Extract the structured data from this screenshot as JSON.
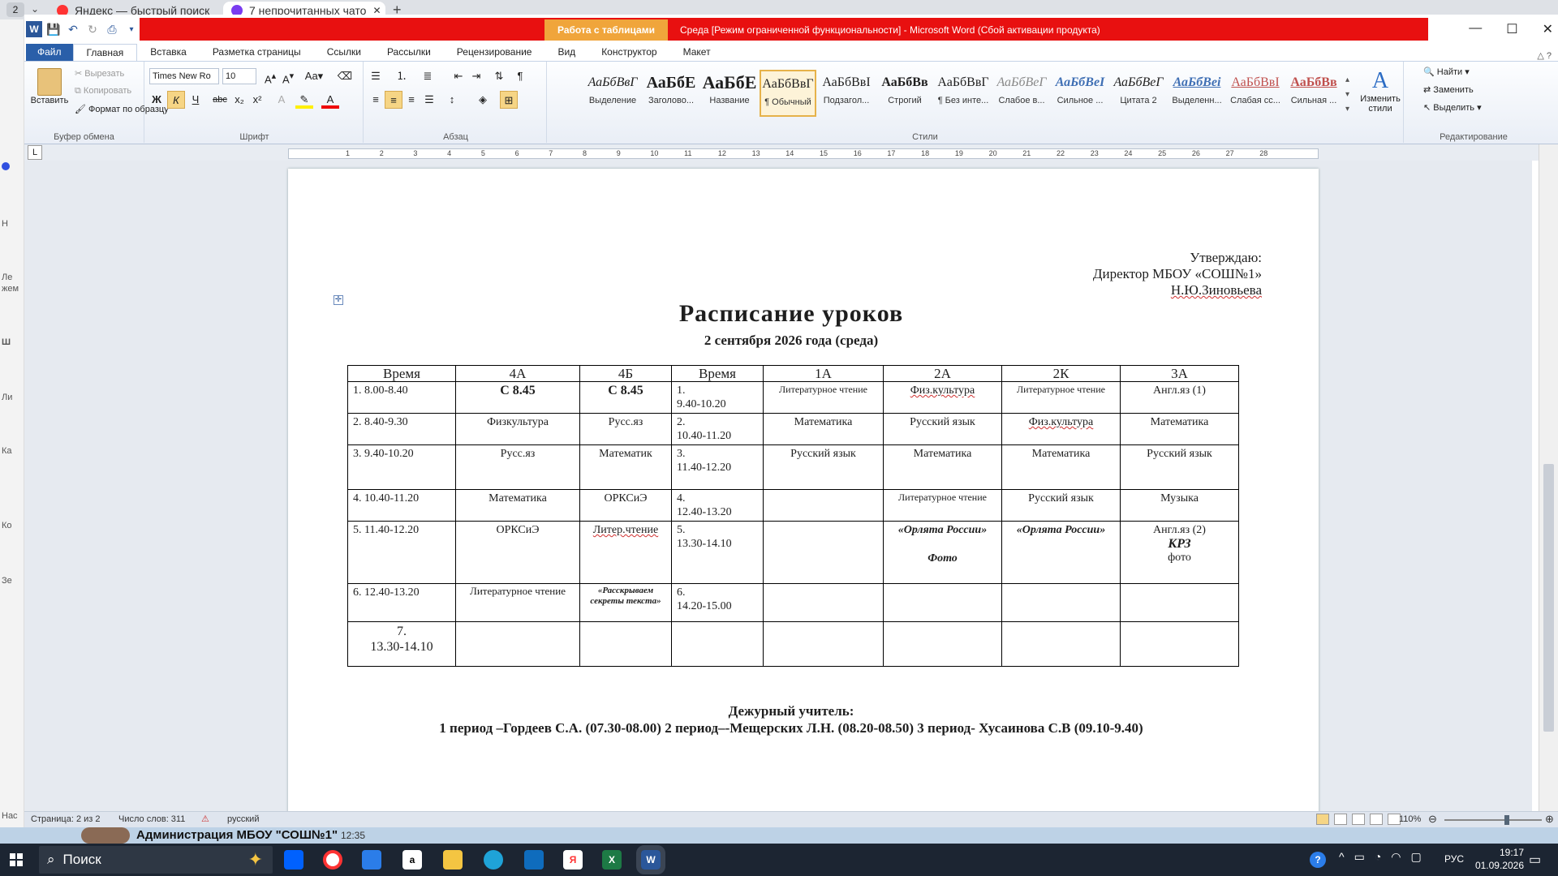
{
  "browser": {
    "tab_count": "2",
    "tabs": [
      {
        "title": "Яндекс — быстрый поиск"
      },
      {
        "title": "7 непрочитанных чато"
      }
    ],
    "sidebar_labels": [
      "Н",
      "Ле",
      "жем",
      "Ш",
      "Ли",
      "Ка",
      "Ко",
      "Зе",
      "Нас"
    ]
  },
  "word": {
    "contextual_tab": "Работа с таблицами",
    "window_title": "Среда [Режим ограниченной функциональности] - Microsoft Word (Сбой активации продукта)",
    "ribbon_tabs": [
      "Файл",
      "Главная",
      "Вставка",
      "Разметка страницы",
      "Ссылки",
      "Рассылки",
      "Рецензирование",
      "Вид",
      "Конструктор",
      "Макет"
    ],
    "active_tab": "Главная",
    "clipboard": {
      "paste": "Вставить",
      "cut": "Вырезать",
      "copy": "Копировать",
      "format_painter": "Формат по образцу",
      "label": "Буфер обмена"
    },
    "font": {
      "name": "Times New Ro",
      "size": "10",
      "label": "Шрифт",
      "bold": "Ж",
      "italic": "К",
      "underline": "Ч"
    },
    "paragraph": {
      "label": "Абзац"
    },
    "styles": {
      "label": "Стили",
      "items": [
        {
          "preview": "АаБбВвГ",
          "name": "Выделение"
        },
        {
          "preview": "АаБбЕ",
          "name": "Заголово..."
        },
        {
          "preview": "АаБбЕ",
          "name": "Название"
        },
        {
          "preview": "АаБбВвГ",
          "name": "¶ Обычный"
        },
        {
          "preview": "АаБбВвI",
          "name": "Подзагол..."
        },
        {
          "preview": "АаБбВв",
          "name": "Строгий"
        },
        {
          "preview": "АаБбВвГ",
          "name": "¶ Без инте..."
        },
        {
          "preview": "АаБбВеГ",
          "name": "Слабое в..."
        },
        {
          "preview": "АаБбВеІ",
          "name": "Сильное ..."
        },
        {
          "preview": "АаБбВеГ",
          "name": "Цитата 2"
        },
        {
          "preview": "АаБбВеі",
          "name": "Выделенн..."
        },
        {
          "preview": "АаБбВвІ",
          "name": "Слабая сс..."
        },
        {
          "preview": "АаБбВв",
          "name": "Сильная ..."
        }
      ],
      "change": "Изменить стили"
    },
    "editing": {
      "label": "Редактирование",
      "find": "Найти",
      "replace": "Заменить",
      "select": "Выделить"
    },
    "ruler_numbers": [
      "1",
      "2",
      "3",
      "4",
      "5",
      "6",
      "7",
      "8",
      "9",
      "10",
      "11",
      "12",
      "13",
      "14",
      "15",
      "16",
      "17",
      "18",
      "19",
      "20",
      "21",
      "22",
      "23",
      "24",
      "25",
      "26",
      "27",
      "28"
    ]
  },
  "document": {
    "approve": [
      "Утверждаю:",
      "Директор МБОУ «СОШ№1»",
      "Н.Ю.Зиновьева"
    ],
    "title": "Расписание  уроков",
    "subtitle": "2 сентября   2026 года (среда)",
    "table": {
      "headers": [
        "Время",
        "4А",
        "4Б",
        "Время",
        "1А",
        "2А",
        "2К",
        "3А"
      ],
      "rows": [
        [
          "1. 8.00-8.40",
          "С 8.45",
          "С 8.45",
          "1.\n 9.40-10.20",
          "Литературное чтение",
          "Физ.культура",
          "Литературное чтение",
          "Англ.яз (1)"
        ],
        [
          "2. 8.40-9.30",
          "Физкультура",
          "Русс.яз",
          "2.\n 10.40-11.20",
          "Математика",
          "Русский язык",
          "Физ.культура",
          "Математика"
        ],
        [
          "3. 9.40-10.20",
          "Русс.яз",
          "Математик",
          "3.\n11.40-12.20",
          "Русский язык",
          "Математика",
          "Математика",
          "Русский язык"
        ],
        [
          "4. 10.40-11.20",
          "Математика",
          "ОРКСиЭ",
          "4.\n12.40-13.20",
          "",
          "Литературное чтение",
          "Русский язык",
          "Музыка"
        ],
        [
          "5. 11.40-12.20",
          "ОРКСиЭ",
          "Литер.чтение",
          "5.\n13.30-14.10",
          "",
          "«Орлята России»",
          "«Орлята России»",
          "Англ.яз (2)"
        ],
        [
          "6. 12.40-13.20",
          "Литературное чтение",
          "«Расскрываем секреты текста»",
          "6.\n14.20-15.00",
          "",
          "",
          "",
          ""
        ],
        [
          "7.\n13.30-14.10",
          "",
          "",
          "",
          "",
          "",
          "",
          ""
        ]
      ],
      "extra": {
        "r5_2a_sub": "Фото",
        "r5_3a_krz": "КРЗ",
        "r5_3a_photo": "фото"
      }
    },
    "duty_title": "Дежурный учитель:",
    "duty_line": "1 период –Гордеев С.А.  (07.30-08.00) 2 период–-Мещерских Л.Н. (08.20-08.50) 3 период- Хусаинова С.В (09.10-9.40)"
  },
  "status": {
    "page": "Страница: 2 из 2",
    "words": "Число слов: 311",
    "language": "русский",
    "zoom": "110%"
  },
  "notification": {
    "text": "Администрация МБОУ \"СОШ№1\"",
    "time": "12:35"
  },
  "taskbar": {
    "search": "Поиск",
    "lang": "РУС",
    "time": "19:17",
    "date": "01.09.2026"
  }
}
